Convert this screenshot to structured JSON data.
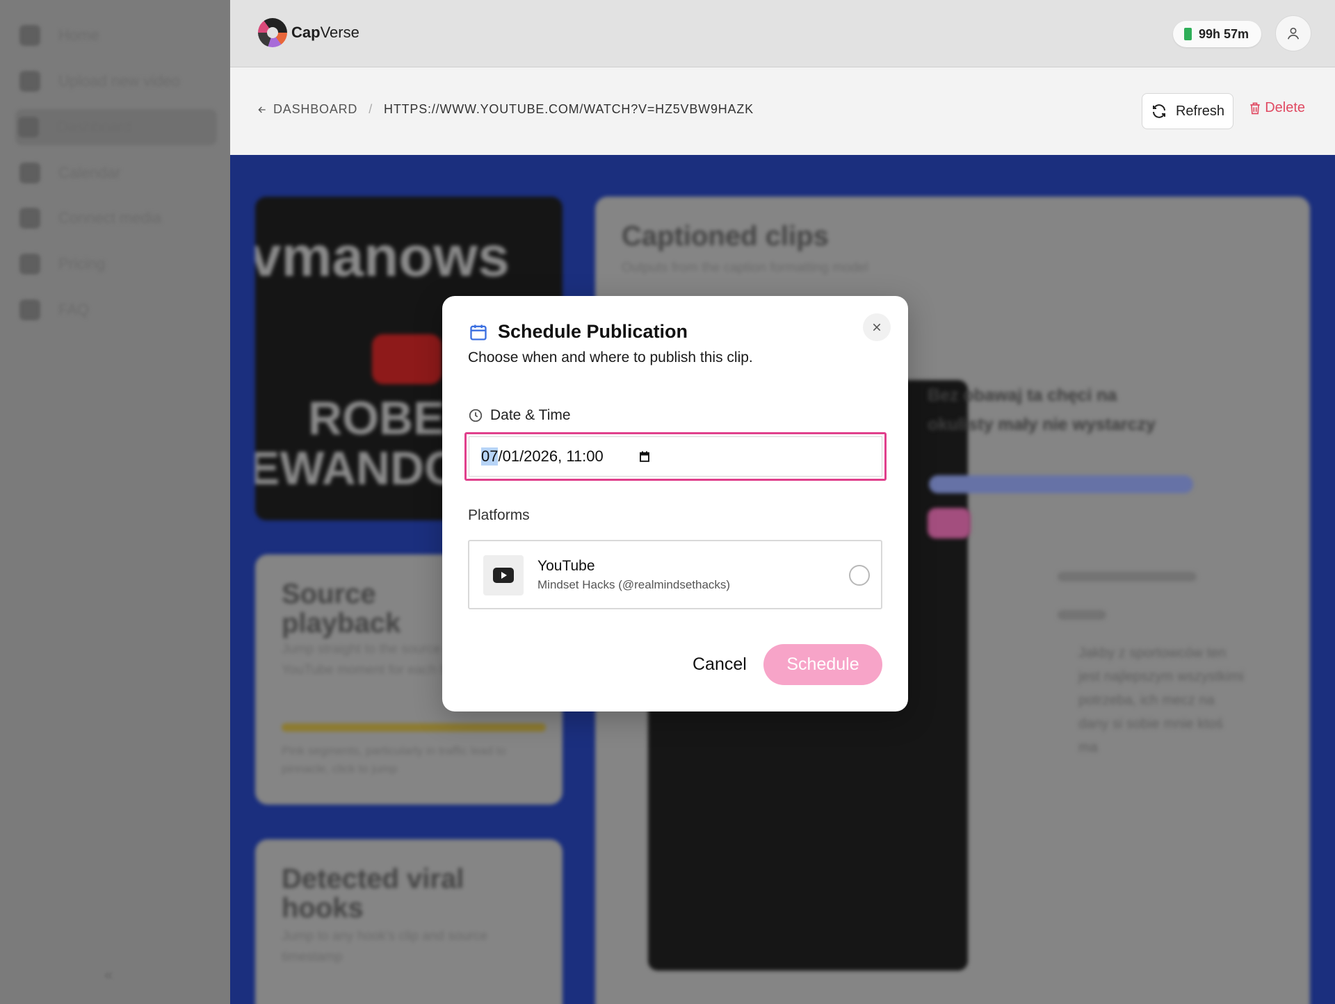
{
  "app": {
    "name_bold": "Cap",
    "name_rest": "Verse"
  },
  "sidebar": {
    "items": [
      {
        "label": "Home",
        "icon": "home-icon"
      },
      {
        "label": "Upload new video",
        "icon": "user-upload-icon"
      },
      {
        "label": "Dashboard",
        "icon": "grid-icon",
        "active": true
      },
      {
        "label": "Calendar",
        "icon": "calendar-icon"
      },
      {
        "label": "Connect media",
        "icon": "link-icon"
      },
      {
        "label": "Pricing",
        "icon": "tag-icon"
      },
      {
        "label": "FAQ",
        "icon": "help-icon"
      }
    ],
    "collapse": "«"
  },
  "topbar": {
    "credits": "99h 57m",
    "credits_icon": "battery-icon",
    "avatar_icon": "user-icon"
  },
  "header": {
    "back_label": "DASHBOARD",
    "separator": "/",
    "current_url": "HTTPS://WWW.YOUTUBE.COM/WATCH?V=HZ5VBW9HAZK",
    "refresh_label": "Refresh",
    "delete_label": "Delete",
    "delete_color": "#e04a62"
  },
  "background": {
    "thumb_words": [
      "vmanows",
      "ROBE",
      "EWANDO"
    ],
    "source_title": "Source playback",
    "source_desc": "Jump straight to the source YouTube moment for each hook",
    "source_note": "Pink segments, particularly in traffic lead to pinnacle, click to jump",
    "hooks_title": "Detected viral hooks",
    "hooks_desc": "Jump to any hook's clip and source timestamp",
    "clips_title": "Captioned clips",
    "clips_desc": "Outputs from the caption formatting model",
    "clip_title": "Bez obawaj ta chęci na okulisty mały nie wystarczy",
    "clip_text": "Jakby z sportowców ten jest najlepszym wszystkimi potrzeba, ich mecz na dany si sobie mnie ktoś ma"
  },
  "dialog": {
    "title": "Schedule Publication",
    "title_icon": "calendar-icon",
    "description": "Choose when and where to publish this clip.",
    "datetime_label": "Date & Time",
    "datetime_icon": "clock-icon",
    "datetime_month": "07",
    "datetime_rest": "/01/2026, 11:00",
    "platforms_label": "Platforms",
    "platforms": [
      {
        "name": "YouTube",
        "handle": "Mindset Hacks (@realmindsethacks)",
        "icon": "youtube-icon",
        "selected": false
      }
    ],
    "cancel_label": "Cancel",
    "schedule_label": "Schedule",
    "accent_color": "#e0408c",
    "schedule_bg": "#f7a4c8"
  }
}
